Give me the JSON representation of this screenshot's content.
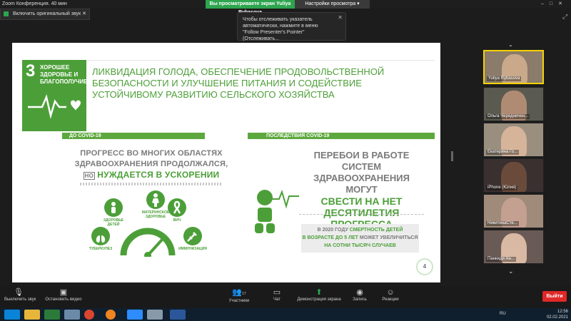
{
  "titlebar": {
    "app_title": "Zoom Конференция. 40 мин",
    "share_notice": "Вы просматриваете экран Yuliya Rybasova",
    "view_options": "Настройки просмотра"
  },
  "audio_button": {
    "label": "Включить оригинальный звук"
  },
  "notification": {
    "text": "Чтобы отслеживать указатель автоматически, нажмите в меню \"Follow Presenter's Pointer\" (Отслеживать..."
  },
  "slide": {
    "sdg_number": "3",
    "sdg_title": "ХОРОШЕЕ ЗДОРОВЬЕ И БЛАГОПОЛУЧИЕ",
    "heading": "ЛИКВИДАЦИЯ ГОЛОДА, ОБЕСПЕЧЕНИЕ ПРОДОВОЛЬСТВЕННОЙ БЕЗОПАСНОСТИ И УЛУЧШЕНИЕ ПИТАНИЯ И СОДЕЙСТВИЕ УСТОЙЧИВОМУ РАЗВИТИЮ СЕЛЬСКОГО ХОЗЯЙСТВА",
    "left_banner": "ДО COVID-19",
    "right_banner": "ПОСЛЕДСТВИЯ COVID-19",
    "left_text_1": "ПРОГРЕСС ВО МНОГИХ ОБЛАСТЯХ",
    "left_text_2": "ЗДРАВООХРАНЕНИЯ ПРОДОЛЖАЛСЯ,",
    "left_text_no": "НО",
    "left_text_3": "НУЖДАЕТСЯ В УСКОРЕНИИ",
    "icon_labels": {
      "children": "ЗДОРОВЬЕ ДЕТЕЙ",
      "maternal": "МАТЕРИНСКОЕ ЗДОРОВЬЕ",
      "hiv": "ВИЧ",
      "tb": "ТУБЕРКУЛЕЗ",
      "immunization": "ИММУНИЗАЦИЯ"
    },
    "right_text_1": "ПЕРЕБОИ В РАБОТЕ СИСТЕМ",
    "right_text_2": "ЗДРАВООХРАНЕНИЯ МОГУТ",
    "right_text_3": "СВЕСТИ НА НЕТ",
    "right_text_4": "ДЕСЯТИЛЕТИЯ ПРОГРЕССА",
    "box_line_1a": "В 2020 ГОДУ",
    "box_line_1b": "СМЕРТНОСТЬ ДЕТЕЙ",
    "box_line_2a": "В ВОЗРАСТЕ ДО 5 ЛЕТ",
    "box_line_2b": "МОЖЕТ",
    "box_line_2c": "УВЕЛИЧИТЬСЯ",
    "box_line_3": "НА СОТНИ ТЫСЯЧ СЛУЧАЕВ",
    "page_number": "4"
  },
  "participants": [
    {
      "name": "Yuliya Rybasova",
      "active": true,
      "face": "#c9a98a",
      "bg": "#8a7b6a"
    },
    {
      "name": "Ольга Чередничен...",
      "active": false,
      "face": "#b08b74",
      "bg": "#5a5a50"
    },
    {
      "name": "Екатерина Го...",
      "active": false,
      "face": "#d6b49a",
      "bg": "#9a8e7e"
    },
    {
      "name": "iPhone (Юлия)",
      "active": false,
      "face": "#6a4b3b",
      "bg": "#3a3030"
    },
    {
      "name": "НикитинаСте...",
      "active": false,
      "face": "#c4a090",
      "bg": "#a08a7a"
    },
    {
      "name": "Панкиди Ан...",
      "active": false,
      "face": "#d9b8a4",
      "bg": "#6a5a55"
    }
  ],
  "toolbar": {
    "mute": "Выключить звук",
    "video": "Остановить видео",
    "participants_count": "17",
    "participants": "Участники",
    "chat": "Чат",
    "share": "Демонстрация экрана",
    "record": "Запись",
    "reactions": "Реакции",
    "leave": "Выйти"
  },
  "tray": {
    "lang": "RU",
    "time": "12:56",
    "date": "02.02.2021"
  },
  "colors": {
    "sdg_green": "#4c9f38",
    "zoom_green": "#2da44e",
    "leave_red": "#e02828"
  }
}
